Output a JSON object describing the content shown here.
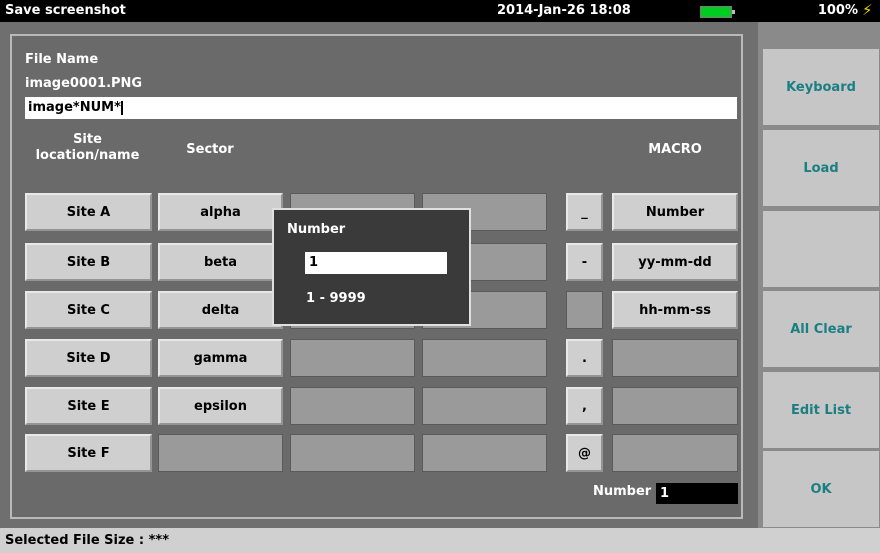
{
  "titlebar": {
    "title": "Save screenshot",
    "datetime": "2014-Jan-26 18:08",
    "battery_percent": "100%",
    "battery_color": "#00cc22"
  },
  "dialog": {
    "file_name_label": "File Name",
    "file_name_preview": "image0001.PNG",
    "file_name_value": "image*NUM*",
    "col_site_label": "Site location/name",
    "col_sector_label": "Sector",
    "col_macro_label": "MACRO",
    "sites": [
      "Site A",
      "Site B",
      "Site C",
      "Site D",
      "Site E",
      "Site F"
    ],
    "sectors": [
      "alpha",
      "beta",
      "delta",
      "gamma",
      "epsilon",
      ""
    ],
    "symbols": [
      "_",
      "-",
      "",
      ".",
      ",",
      "@"
    ],
    "macros": [
      "Number",
      "yy-mm-dd",
      "hh-mm-ss",
      "",
      "",
      ""
    ],
    "number_label": "Number",
    "number_value": "1"
  },
  "popup": {
    "title": "Number",
    "value": "1",
    "range": "1 - 9999"
  },
  "softkeys": [
    "Keyboard",
    "Load",
    "",
    "All Clear",
    "Edit List",
    "OK"
  ],
  "status": {
    "text": "Selected File Size : ***"
  }
}
